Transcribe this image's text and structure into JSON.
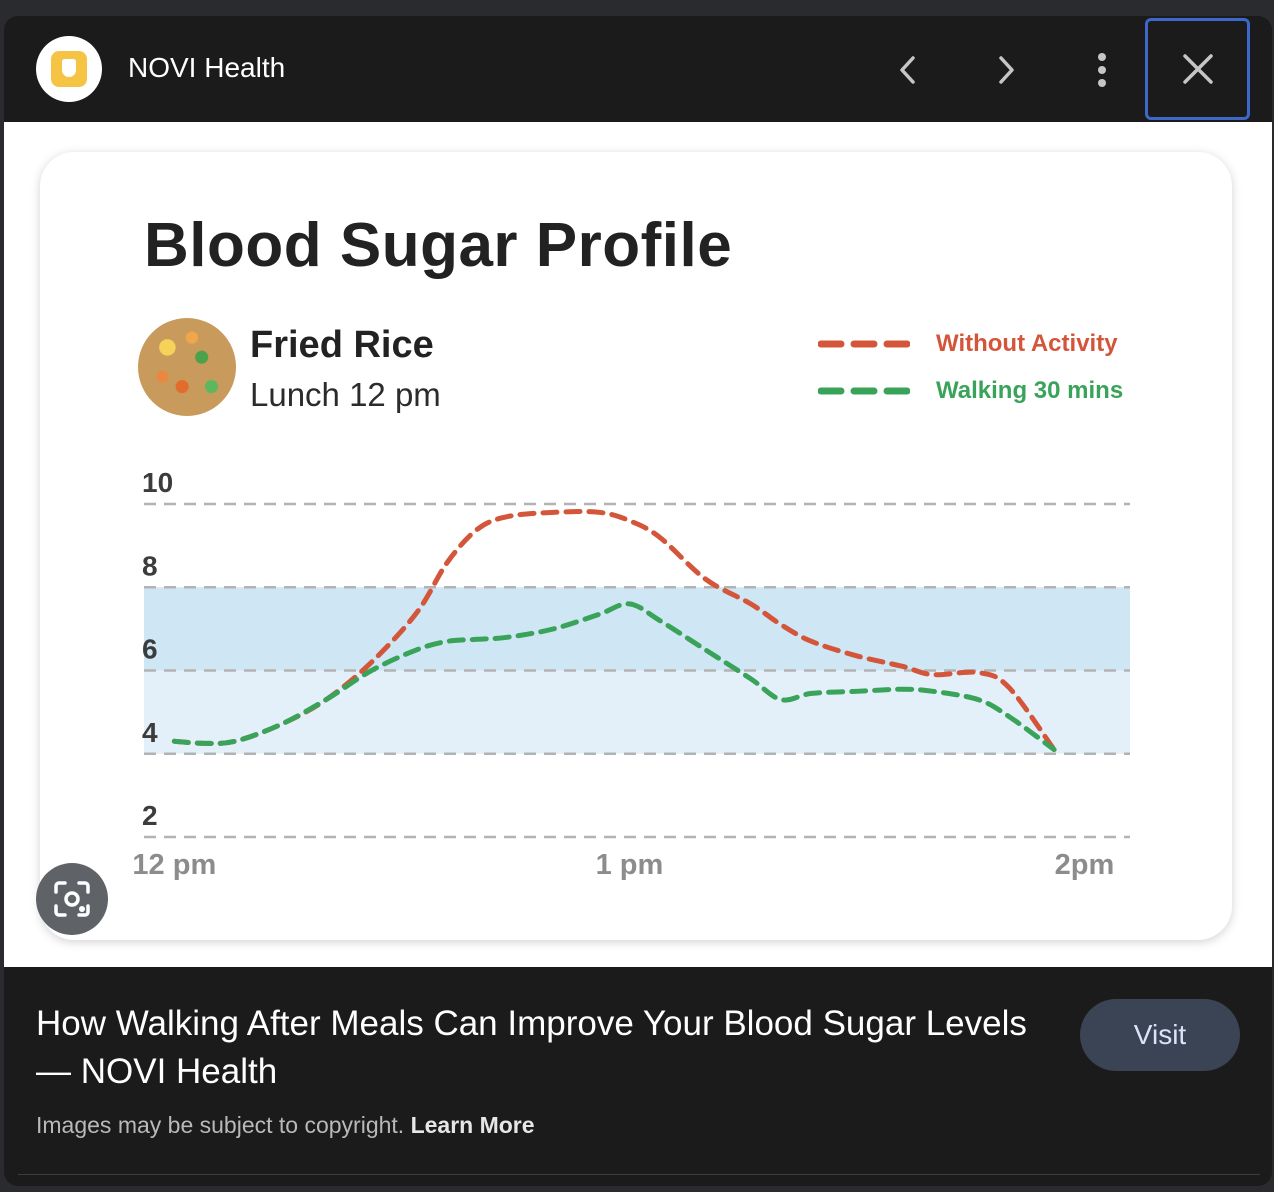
{
  "header": {
    "site_name": "NOVI Health",
    "icons": [
      "chevron-left-icon",
      "chevron-right-icon",
      "more-vert-icon",
      "close-icon"
    ]
  },
  "card": {
    "food_name": "Fried Rice",
    "food_subtitle": "Lunch 12 pm"
  },
  "chart_data": {
    "type": "line",
    "title": "Blood Sugar Profile",
    "x_tick_labels": [
      "12 pm",
      "1 pm",
      "2pm"
    ],
    "y_ticks": [
      10,
      8,
      6,
      4,
      2
    ],
    "ylim": [
      2,
      10
    ],
    "xlim_minutes_after_noon": [
      -4,
      126
    ],
    "shaded_range": [
      4,
      8
    ],
    "grid": true,
    "legend_position": "top-right",
    "series": [
      {
        "name": "Without Activity",
        "color": "#d4563a",
        "x": [
          0,
          4,
          8,
          14,
          20,
          26,
          32,
          36,
          40,
          44,
          50,
          56,
          60,
          64,
          70,
          76,
          80,
          84,
          90,
          96,
          100,
          106,
          110,
          116
        ],
        "y": [
          4.3,
          4.25,
          4.3,
          4.7,
          5.3,
          6.2,
          7.4,
          8.6,
          9.4,
          9.7,
          9.8,
          9.8,
          9.6,
          9.2,
          8.2,
          7.6,
          7.1,
          6.7,
          6.35,
          6.1,
          5.9,
          5.95,
          5.6,
          4.1
        ]
      },
      {
        "name": "Walking 30 mins",
        "color": "#3aa35a",
        "x": [
          0,
          4,
          8,
          14,
          20,
          26,
          32,
          36,
          40,
          44,
          50,
          56,
          60,
          64,
          70,
          76,
          80,
          84,
          90,
          96,
          100,
          106,
          110,
          116
        ],
        "y": [
          4.3,
          4.25,
          4.3,
          4.7,
          5.3,
          6.0,
          6.5,
          6.7,
          6.75,
          6.8,
          7.0,
          7.35,
          7.6,
          7.2,
          6.5,
          5.8,
          5.3,
          5.45,
          5.5,
          5.55,
          5.5,
          5.3,
          4.9,
          4.1
        ]
      }
    ]
  },
  "caption": {
    "title": "How Walking After Meals Can Improve Your Blood Sugar Levels — NOVI Health",
    "visit_label": "Visit",
    "copyright_text": "Images may be subject to copyright.",
    "learn_more": "Learn More"
  }
}
